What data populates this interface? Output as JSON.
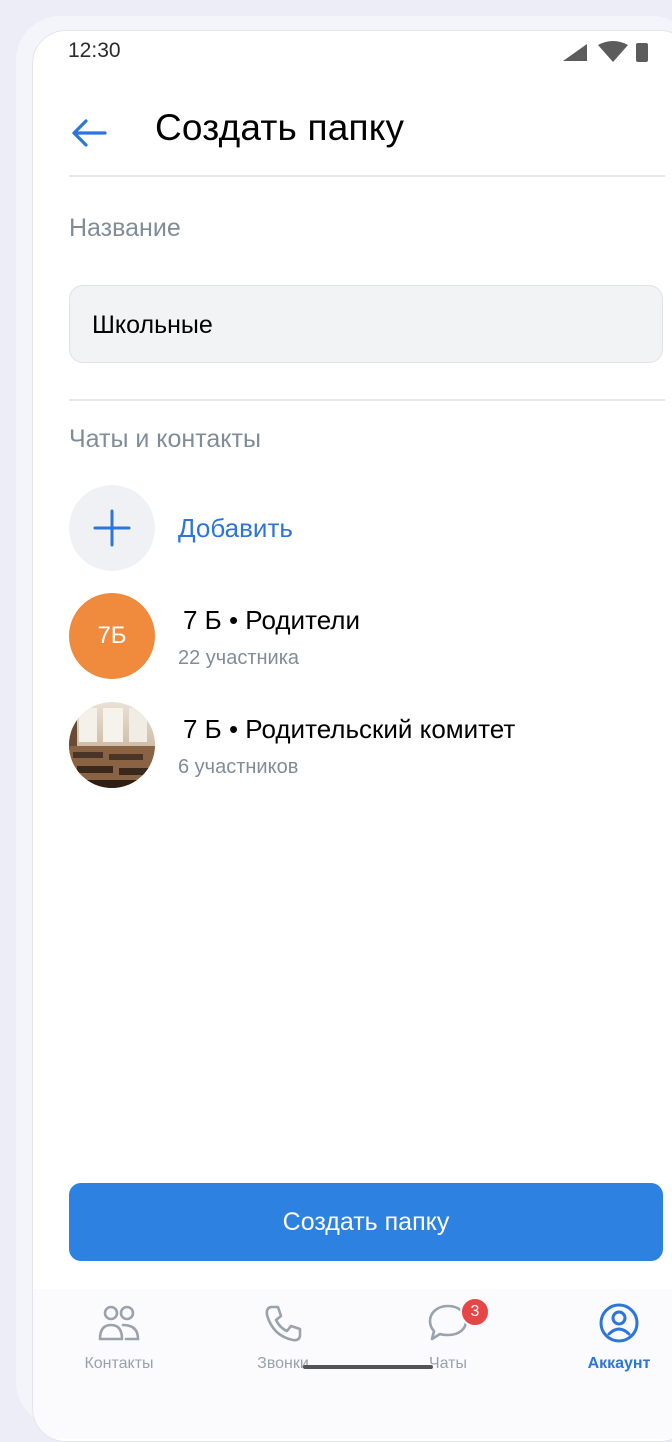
{
  "status_bar": {
    "time": "12:30"
  },
  "header": {
    "title": "Создать папку"
  },
  "name_section": {
    "label": "Название",
    "value": "Школьные"
  },
  "chats_section": {
    "label": "Чаты и контакты",
    "add_label": "Добавить",
    "items": [
      {
        "name": "7 Б • Родители",
        "subtitle": "22 участника",
        "avatar_initials": "7Б",
        "avatar_color": "#f08a3c"
      },
      {
        "name": "7 Б • Родительский комитет",
        "subtitle": "6 участников",
        "avatar_type": "photo"
      }
    ]
  },
  "create_button": {
    "label": "Создать папку"
  },
  "tab_bar": {
    "items": [
      {
        "label": "Контакты",
        "icon": "contacts-icon"
      },
      {
        "label": "Звонки",
        "icon": "phone-icon"
      },
      {
        "label": "Чаты",
        "icon": "chat-bubble-icon",
        "badge": "3"
      },
      {
        "label": "Аккаунт",
        "icon": "account-icon",
        "active": true
      }
    ]
  },
  "colors": {
    "accent": "#2d81e0",
    "link": "#2c75d9",
    "badge": "#e64646",
    "secondary_text": "#818c99"
  }
}
